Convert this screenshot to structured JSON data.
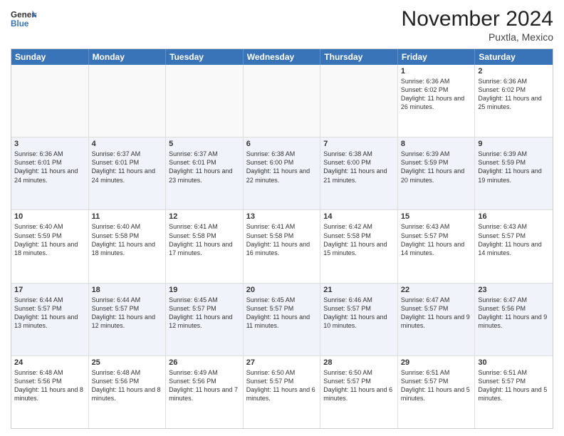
{
  "logo": {
    "line1": "General",
    "line2": "Blue"
  },
  "title": "November 2024",
  "location": "Puxtla, Mexico",
  "weekdays": [
    "Sunday",
    "Monday",
    "Tuesday",
    "Wednesday",
    "Thursday",
    "Friday",
    "Saturday"
  ],
  "rows": [
    [
      {
        "day": "",
        "detail": "",
        "empty": true
      },
      {
        "day": "",
        "detail": "",
        "empty": true
      },
      {
        "day": "",
        "detail": "",
        "empty": true
      },
      {
        "day": "",
        "detail": "",
        "empty": true
      },
      {
        "day": "",
        "detail": "",
        "empty": true
      },
      {
        "day": "1",
        "detail": "Sunrise: 6:36 AM\nSunset: 6:02 PM\nDaylight: 11 hours\nand 26 minutes.",
        "empty": false
      },
      {
        "day": "2",
        "detail": "Sunrise: 6:36 AM\nSunset: 6:02 PM\nDaylight: 11 hours\nand 25 minutes.",
        "empty": false
      }
    ],
    [
      {
        "day": "3",
        "detail": "Sunrise: 6:36 AM\nSunset: 6:01 PM\nDaylight: 11 hours\nand 24 minutes.",
        "empty": false
      },
      {
        "day": "4",
        "detail": "Sunrise: 6:37 AM\nSunset: 6:01 PM\nDaylight: 11 hours\nand 24 minutes.",
        "empty": false
      },
      {
        "day": "5",
        "detail": "Sunrise: 6:37 AM\nSunset: 6:01 PM\nDaylight: 11 hours\nand 23 minutes.",
        "empty": false
      },
      {
        "day": "6",
        "detail": "Sunrise: 6:38 AM\nSunset: 6:00 PM\nDaylight: 11 hours\nand 22 minutes.",
        "empty": false
      },
      {
        "day": "7",
        "detail": "Sunrise: 6:38 AM\nSunset: 6:00 PM\nDaylight: 11 hours\nand 21 minutes.",
        "empty": false
      },
      {
        "day": "8",
        "detail": "Sunrise: 6:39 AM\nSunset: 5:59 PM\nDaylight: 11 hours\nand 20 minutes.",
        "empty": false
      },
      {
        "day": "9",
        "detail": "Sunrise: 6:39 AM\nSunset: 5:59 PM\nDaylight: 11 hours\nand 19 minutes.",
        "empty": false
      }
    ],
    [
      {
        "day": "10",
        "detail": "Sunrise: 6:40 AM\nSunset: 5:59 PM\nDaylight: 11 hours\nand 18 minutes.",
        "empty": false
      },
      {
        "day": "11",
        "detail": "Sunrise: 6:40 AM\nSunset: 5:58 PM\nDaylight: 11 hours\nand 18 minutes.",
        "empty": false
      },
      {
        "day": "12",
        "detail": "Sunrise: 6:41 AM\nSunset: 5:58 PM\nDaylight: 11 hours\nand 17 minutes.",
        "empty": false
      },
      {
        "day": "13",
        "detail": "Sunrise: 6:41 AM\nSunset: 5:58 PM\nDaylight: 11 hours\nand 16 minutes.",
        "empty": false
      },
      {
        "day": "14",
        "detail": "Sunrise: 6:42 AM\nSunset: 5:58 PM\nDaylight: 11 hours\nand 15 minutes.",
        "empty": false
      },
      {
        "day": "15",
        "detail": "Sunrise: 6:43 AM\nSunset: 5:57 PM\nDaylight: 11 hours\nand 14 minutes.",
        "empty": false
      },
      {
        "day": "16",
        "detail": "Sunrise: 6:43 AM\nSunset: 5:57 PM\nDaylight: 11 hours\nand 14 minutes.",
        "empty": false
      }
    ],
    [
      {
        "day": "17",
        "detail": "Sunrise: 6:44 AM\nSunset: 5:57 PM\nDaylight: 11 hours\nand 13 minutes.",
        "empty": false
      },
      {
        "day": "18",
        "detail": "Sunrise: 6:44 AM\nSunset: 5:57 PM\nDaylight: 11 hours\nand 12 minutes.",
        "empty": false
      },
      {
        "day": "19",
        "detail": "Sunrise: 6:45 AM\nSunset: 5:57 PM\nDaylight: 11 hours\nand 12 minutes.",
        "empty": false
      },
      {
        "day": "20",
        "detail": "Sunrise: 6:45 AM\nSunset: 5:57 PM\nDaylight: 11 hours\nand 11 minutes.",
        "empty": false
      },
      {
        "day": "21",
        "detail": "Sunrise: 6:46 AM\nSunset: 5:57 PM\nDaylight: 11 hours\nand 10 minutes.",
        "empty": false
      },
      {
        "day": "22",
        "detail": "Sunrise: 6:47 AM\nSunset: 5:57 PM\nDaylight: 11 hours\nand 9 minutes.",
        "empty": false
      },
      {
        "day": "23",
        "detail": "Sunrise: 6:47 AM\nSunset: 5:56 PM\nDaylight: 11 hours\nand 9 minutes.",
        "empty": false
      }
    ],
    [
      {
        "day": "24",
        "detail": "Sunrise: 6:48 AM\nSunset: 5:56 PM\nDaylight: 11 hours\nand 8 minutes.",
        "empty": false
      },
      {
        "day": "25",
        "detail": "Sunrise: 6:48 AM\nSunset: 5:56 PM\nDaylight: 11 hours\nand 8 minutes.",
        "empty": false
      },
      {
        "day": "26",
        "detail": "Sunrise: 6:49 AM\nSunset: 5:56 PM\nDaylight: 11 hours\nand 7 minutes.",
        "empty": false
      },
      {
        "day": "27",
        "detail": "Sunrise: 6:50 AM\nSunset: 5:57 PM\nDaylight: 11 hours\nand 6 minutes.",
        "empty": false
      },
      {
        "day": "28",
        "detail": "Sunrise: 6:50 AM\nSunset: 5:57 PM\nDaylight: 11 hours\nand 6 minutes.",
        "empty": false
      },
      {
        "day": "29",
        "detail": "Sunrise: 6:51 AM\nSunset: 5:57 PM\nDaylight: 11 hours\nand 5 minutes.",
        "empty": false
      },
      {
        "day": "30",
        "detail": "Sunrise: 6:51 AM\nSunset: 5:57 PM\nDaylight: 11 hours\nand 5 minutes.",
        "empty": false
      }
    ]
  ]
}
